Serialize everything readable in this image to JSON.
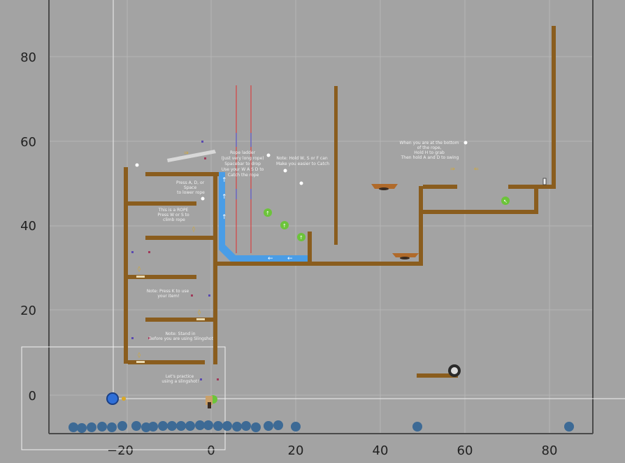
{
  "axes": {
    "x_ticks": [
      "−20",
      "0",
      "20",
      "40",
      "60",
      "80"
    ],
    "y_ticks": [
      "0",
      "20",
      "40",
      "60",
      "80"
    ]
  },
  "notes": {
    "rope_ladder": [
      "Rope ladder",
      "(Just very long rope)",
      "Spacebar to drop",
      "Use your W A S D to",
      "Catch the rope"
    ],
    "hold_ws": [
      "Note: Hold W, S or F can",
      "Make you easier to Catch"
    ],
    "bottom_rope": [
      "When you are at the bottom",
      "of the rope,",
      "Hold H to grab",
      "Then hold A and D to swing"
    ],
    "lower_rope": [
      "Press A, D, or",
      "Space",
      "to lower rope"
    ],
    "climb_rope": [
      "This is a ROPE",
      "Press W or S to",
      "climb rope"
    ],
    "press_kl": [
      "Note: Press K to use",
      "your item!"
    ],
    "stand_in": [
      "Note: Stand in",
      "Before you are using Slingshot"
    ],
    "slingshot": [
      "Let's practice",
      "using a slingshot!"
    ]
  },
  "colors": {
    "background": "#a3a3a3",
    "plot_border": "#4a4a4a",
    "grid": "#b6b6b6",
    "platform": "#8a5d1e",
    "conveyor": "#4a9de6",
    "rope_red": "#d24a4a",
    "player": "#2f6fd8",
    "boulder": "#3d6a95",
    "arrow_pad": "#6cc43a",
    "coin": "#d9a826",
    "note_text": "#f2f2f2"
  },
  "icons": [
    "player-ball-icon",
    "up-arrow-icon",
    "left-arrow-icon",
    "coin-icon",
    "bomb-icon",
    "bottle-icon",
    "spring-icon"
  ]
}
